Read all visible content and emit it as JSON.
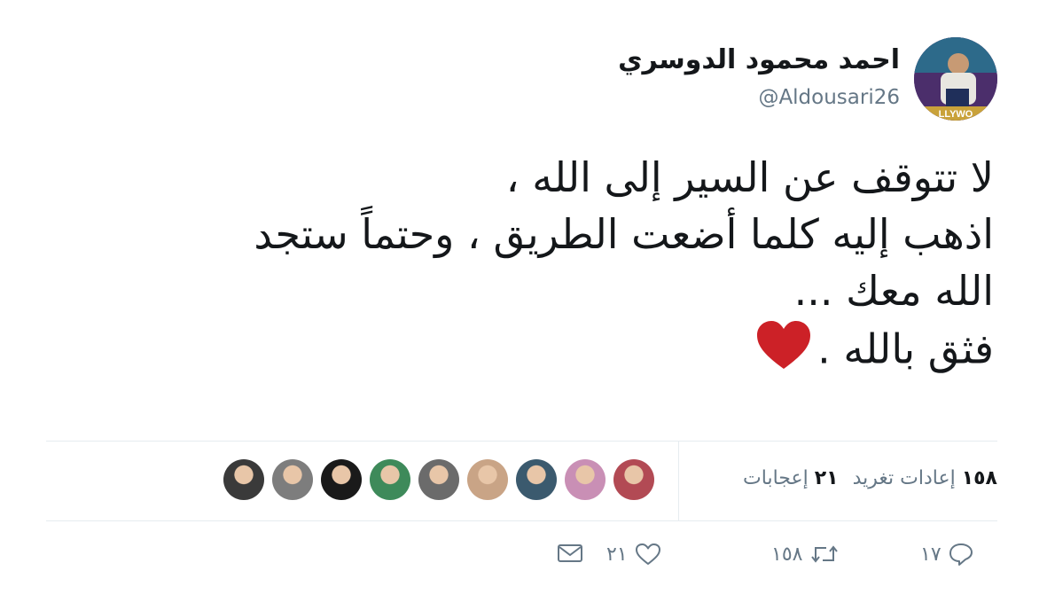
{
  "user": {
    "display_name": "احمد محمود الدوسري",
    "handle": "@Aldousari26",
    "avatar_text": "LLYWO"
  },
  "tweet": {
    "lines": [
      "لا تتوقف عن السير إلى الله ،",
      "اذهب إليه كلما أضعت الطريق ، وحتماً ستجد",
      "الله معك ...",
      "فثق بالله ."
    ],
    "emoji": "heart"
  },
  "stats": {
    "retweets_count": "١٥٨",
    "retweets_label": "إعادات تغريد",
    "likes_count": "٢١",
    "likes_label": "إعجابات"
  },
  "likers": [
    {
      "name": "liker-1",
      "color": "#b24a54"
    },
    {
      "name": "liker-2",
      "color": "#c98fb5"
    },
    {
      "name": "liker-3",
      "color": "#3b5a6e"
    },
    {
      "name": "liker-4",
      "color": "#c9a486"
    },
    {
      "name": "liker-5",
      "color": "#6b6b6b"
    },
    {
      "name": "liker-6",
      "color": "#3e8a5a"
    },
    {
      "name": "liker-7",
      "color": "#1a1a1a"
    },
    {
      "name": "liker-8",
      "color": "#7d7d7d"
    },
    {
      "name": "liker-9",
      "color": "#3a3a3a"
    }
  ],
  "actions": {
    "reply_count": "١٧",
    "retweet_count": "١٥٨",
    "like_count": "٢١"
  },
  "colors": {
    "text": "#14171a",
    "muted": "#657786",
    "divider": "#e6ecf0",
    "heart": "#cc2127"
  }
}
